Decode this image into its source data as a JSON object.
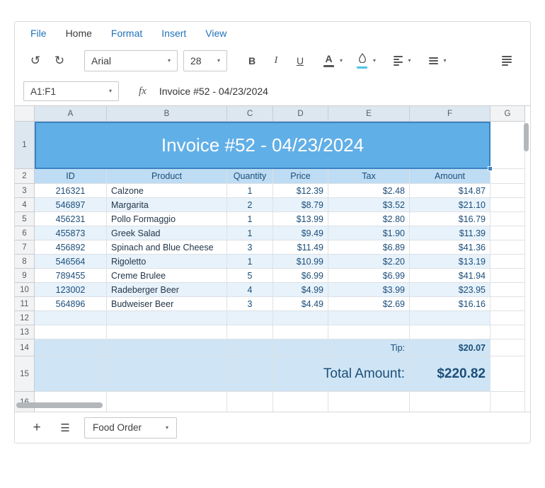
{
  "menu": {
    "items": [
      {
        "label": "File",
        "active": false
      },
      {
        "label": "Home",
        "active": true
      },
      {
        "label": "Format",
        "active": false
      },
      {
        "label": "Insert",
        "active": false
      },
      {
        "label": "View",
        "active": false
      }
    ]
  },
  "icons": {
    "undo": "↺",
    "redo": "↻",
    "caret": "▾",
    "plus": "+",
    "menu": "☰"
  },
  "toolbar": {
    "font_family_value": "Arial",
    "font_size_value": "28",
    "bold": "B",
    "italic": "I",
    "underline": "U",
    "text_color": "A"
  },
  "formula_bar": {
    "reference": "A1:F1",
    "fx": "fx",
    "value": "Invoice #52 - 04/23/2024"
  },
  "sheet": {
    "columns": [
      "A",
      "B",
      "C",
      "D",
      "E",
      "F",
      "G"
    ],
    "visible_row_numbers": [
      1,
      2,
      3,
      4,
      5,
      6,
      7,
      8,
      9,
      10,
      11,
      12,
      13,
      14,
      15,
      16
    ],
    "title_cell": {
      "ref": "A1:F1",
      "text": "Invoice #52 - 04/23/2024"
    },
    "header_row": [
      "ID",
      "Product",
      "Quantity",
      "Price",
      "Tax",
      "Amount"
    ],
    "data_rows": [
      [
        "216321",
        "Calzone",
        "1",
        "$12.39",
        "$2.48",
        "$14.87"
      ],
      [
        "546897",
        "Margarita",
        "2",
        "$8.79",
        "$3.52",
        "$21.10"
      ],
      [
        "456231",
        "Pollo Formaggio",
        "1",
        "$13.99",
        "$2.80",
        "$16.79"
      ],
      [
        "455873",
        "Greek Salad",
        "1",
        "$9.49",
        "$1.90",
        "$11.39"
      ],
      [
        "456892",
        "Spinach and Blue Cheese",
        "3",
        "$11.49",
        "$6.89",
        "$41.36"
      ],
      [
        "546564",
        "Rigoletto",
        "1",
        "$10.99",
        "$2.20",
        "$13.19"
      ],
      [
        "789455",
        "Creme Brulee",
        "5",
        "$6.99",
        "$6.99",
        "$41.94"
      ],
      [
        "123002",
        "Radeberger Beer",
        "4",
        "$4.99",
        "$3.99",
        "$23.95"
      ],
      [
        "564896",
        "Budweiser Beer",
        "3",
        "$4.49",
        "$2.69",
        "$16.16"
      ]
    ],
    "empty_rows": [
      12,
      13,
      16
    ],
    "tip": {
      "row": 14,
      "label": "Tip:",
      "value": "$20.07"
    },
    "total": {
      "row": 15,
      "label": "Total Amount:",
      "value": "$220.82"
    }
  },
  "sheet_bar": {
    "sheet_name": "Food Order"
  },
  "colors": {
    "selection_fill": "#61afe7",
    "selection_border": "#3b82c4",
    "title_text": "#ffffff",
    "header_row_fill": "#bedcf3",
    "band_fill": "#e7f2fb",
    "summary_fill": "#cfe5f5",
    "number_text": "#1c4e79",
    "product_text": "#23364a",
    "menu_link": "#2273b8",
    "menu_active": "#3c3c3c",
    "fill_swatch": "#4dc3e8",
    "text_color_swatch": "#555555",
    "grid_line": "#dde1e5",
    "header_line": "#c9cdd1",
    "header_fill": "#f2f3f4",
    "header_selected_fill": "#dce7f0",
    "scrollbar_thumb": "#b4b7ba"
  }
}
